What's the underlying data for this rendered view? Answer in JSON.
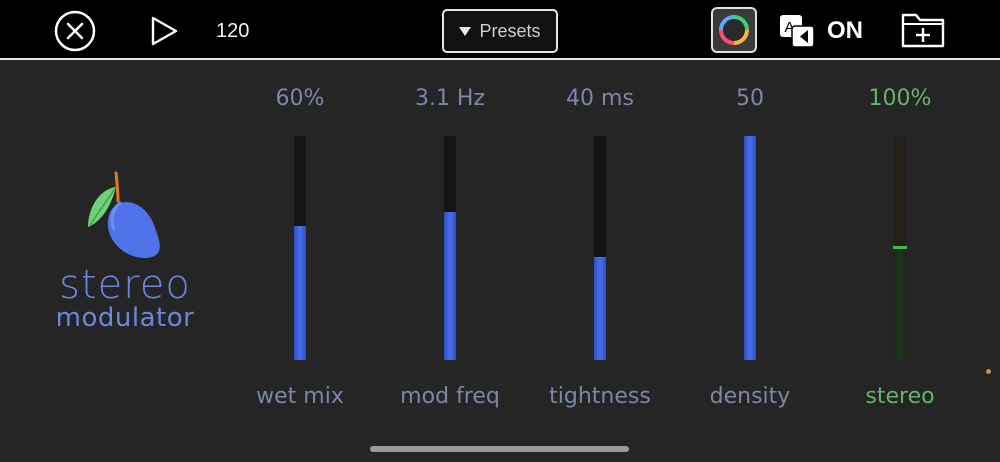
{
  "toolbar": {
    "tempo": "120",
    "presets_label": "Presets",
    "ab_state": "ON",
    "icons": {
      "close": "close-circle-icon",
      "play": "play-icon",
      "theme": "color-ring-icon",
      "ab": "ab-compare-icon",
      "folder": "folder-add-icon"
    }
  },
  "logo": {
    "word1": "stereo",
    "word2": "modulator"
  },
  "sliders": [
    {
      "label": "wet mix",
      "value": "60%",
      "level": 0.6
    },
    {
      "label": "mod freq",
      "value": "3.1 Hz",
      "level": 0.66
    },
    {
      "label": "tightness",
      "value": "40 ms",
      "level": 0.46
    },
    {
      "label": "density",
      "value": "50",
      "level": 1.0
    },
    {
      "label": "stereo",
      "value": "100%",
      "level": 0.5
    }
  ],
  "colors": {
    "background": "#252525",
    "toolbar": "#000000",
    "accent_blue": "#4a70ea",
    "text_blue": "#7c87a6",
    "accent_green": "#66b36a",
    "logo_blue": "#6c86dc"
  }
}
